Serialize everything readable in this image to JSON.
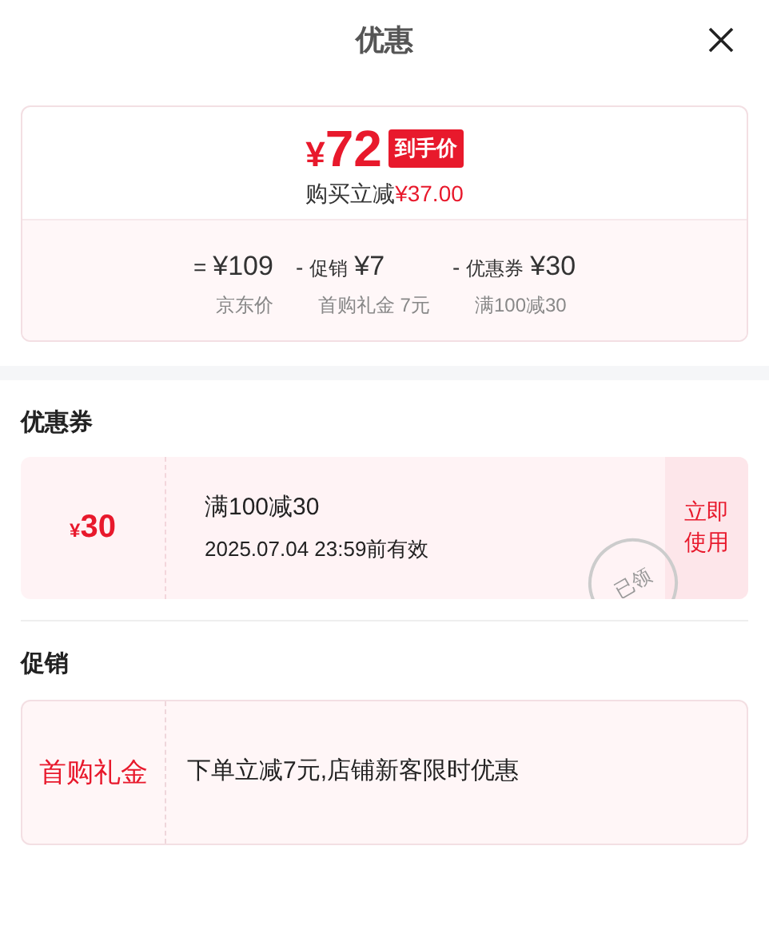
{
  "title": "优惠",
  "summary": {
    "price": "72",
    "currency": "¥",
    "badge": "到手价",
    "saving_label": "购买立减",
    "saving": "¥37.00",
    "breakdown": [
      {
        "op": "=",
        "amount": "¥109",
        "note": "京东价"
      },
      {
        "op": "-",
        "name": "促销",
        "amount": "¥7",
        "note": "首购礼金 7元"
      },
      {
        "op": "-",
        "name": "优惠券",
        "amount": "¥30",
        "note": "满100减30"
      }
    ]
  },
  "coupons": {
    "heading": "优惠券",
    "items": [
      {
        "currency": "¥",
        "amount": "30",
        "condition": "满100减30",
        "validity": "2025.07.04 23:59前有效",
        "stamp": "已领",
        "action": "立即使用"
      }
    ]
  },
  "promotions": {
    "heading": "促销",
    "items": [
      {
        "tag": "首购礼金",
        "description": "下单立减7元,店铺新客限时优惠"
      }
    ]
  }
}
